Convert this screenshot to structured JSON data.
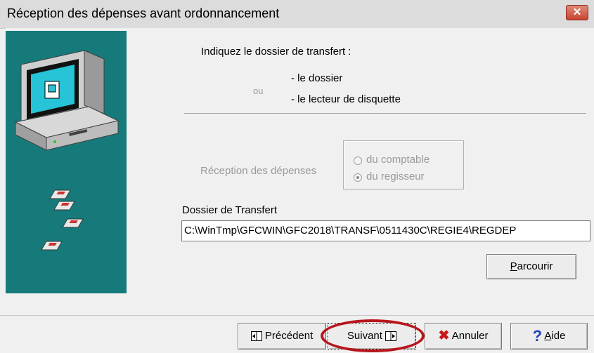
{
  "window": {
    "title": "Réception des dépenses avant ordonnancement",
    "close_symbol": "✕"
  },
  "instructions": {
    "heading": "Indiquez le dossier de transfert :",
    "option_a": "- le dossier",
    "or_text": "ou",
    "option_b": "- le  lecteur de disquette"
  },
  "reception": {
    "label": "Réception des dépenses",
    "options": [
      {
        "label": "du comptable",
        "selected": false
      },
      {
        "label": "du regisseur",
        "selected": true
      }
    ]
  },
  "transfer": {
    "label": "Dossier de Transfert",
    "path": "C:\\WinTmp\\GFCWIN\\GFC2018\\TRANSF\\0511430C\\REGIE4\\REGDEP"
  },
  "buttons": {
    "browse_prefix": "",
    "browse_hotkey": "P",
    "browse_rest": "arcourir",
    "previous": "Précédent",
    "next": "Suivant",
    "cancel": "Annuler",
    "help_hotkey": "A",
    "help_rest": "ide"
  },
  "colors": {
    "side_panel": "#167a7a",
    "highlight_circle": "#b8151c"
  }
}
